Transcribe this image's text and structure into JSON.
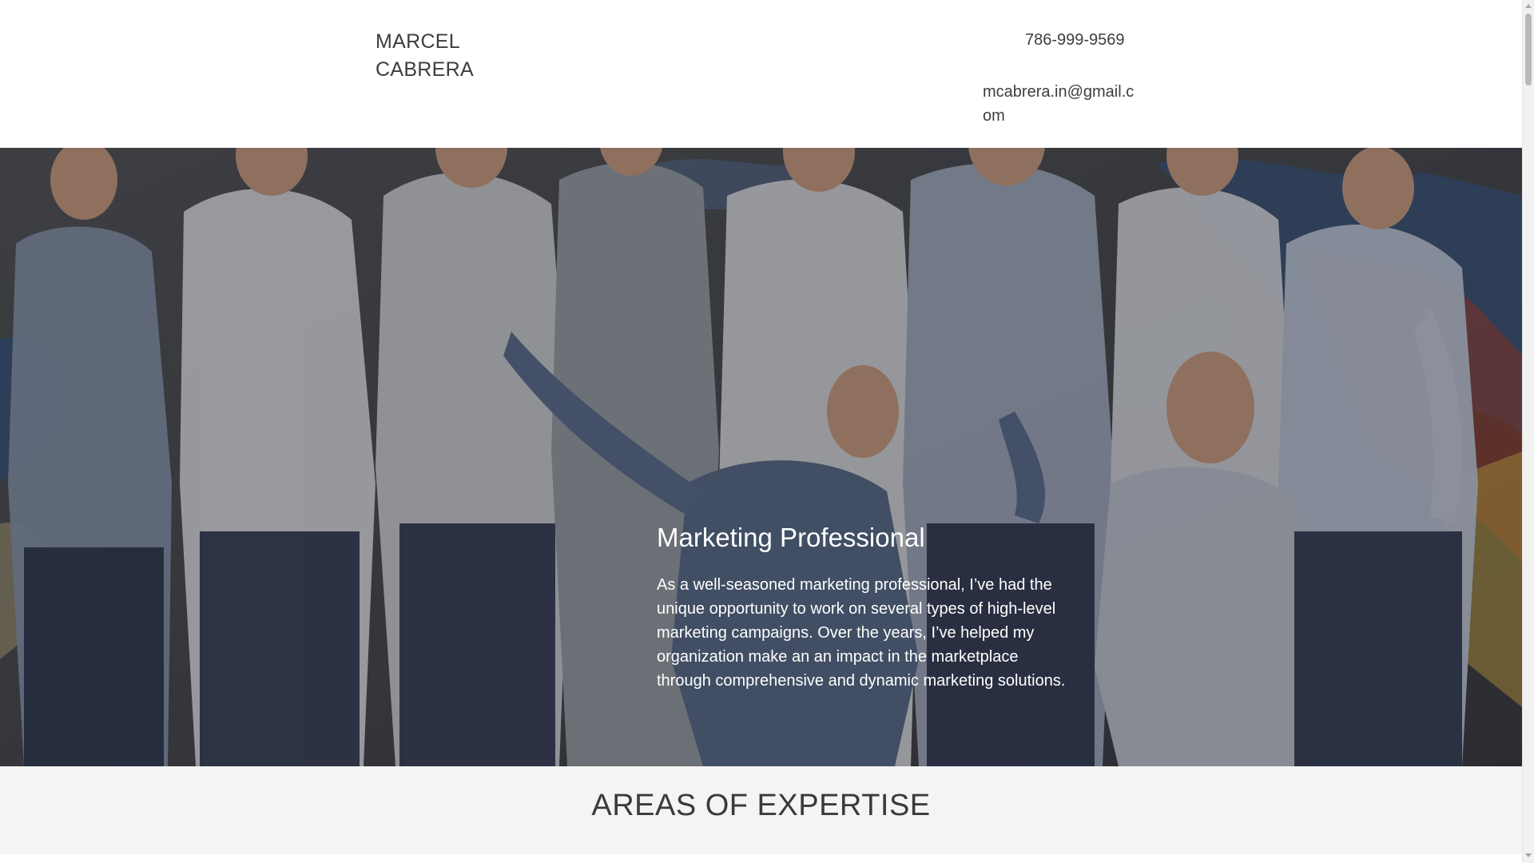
{
  "header": {
    "brand_line1": "MARCEL",
    "brand_line2": "CABRERA",
    "phone": "786-999-9569",
    "email": "mcabrera.in@gmail.com"
  },
  "hero": {
    "title": "Marketing Professional",
    "text": "As a well-seasoned marketing professional, I’ve had the unique opportunity to work on several types of high-level marketing campaigns. Over the years, I’ve helped my organization make an an impact in the marketplace through comprehensive and dynamic marketing solutions.",
    "image_icon": "group-photo-icon"
  },
  "expertise": {
    "title": "AREAS OF EXPERTISE"
  },
  "colors": {
    "header_bg": "#ffffff",
    "text": "#3d3d3d",
    "hero_text": "#ffffff",
    "section_bg": "#f4f4f3"
  }
}
